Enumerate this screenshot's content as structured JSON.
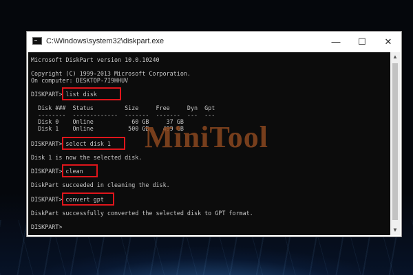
{
  "window": {
    "title": "C:\\Windows\\system32\\diskpart.exe",
    "minimize_glyph": "—",
    "maximize_glyph": "☐",
    "close_glyph": "✕"
  },
  "console": {
    "lines": [
      "Microsoft DiskPart version 10.0.10240",
      "Copyright (C) 1999-2013 Microsoft Corporation.",
      "On computer: DESKTOP-7I9HHUV",
      "DISKPART> list disk",
      "  Disk ###  Status         Size     Free     Dyn  Gpt",
      "  --------  -------------  -------  -------  ---  ---",
      "  Disk 0    Online           60 GB     37 GB",
      "  Disk 1    Online          500 GB    499 GB",
      "DISKPART> select disk 1",
      "Disk 1 is now the selected disk.",
      "DISKPART> clean",
      "DiskPart succeeded in cleaning the disk.",
      "DISKPART> convert gpt",
      "DiskPart successfully converted the selected disk to GPT format.",
      "DISKPART>"
    ]
  },
  "watermark": "MiniTool",
  "colors": {
    "console_bg": "#0c0c0c",
    "console_text": "#c8c8c8",
    "highlight": "#e0151b",
    "watermark": "#8b4820"
  },
  "icons": {
    "title_icon": "console-icon"
  }
}
